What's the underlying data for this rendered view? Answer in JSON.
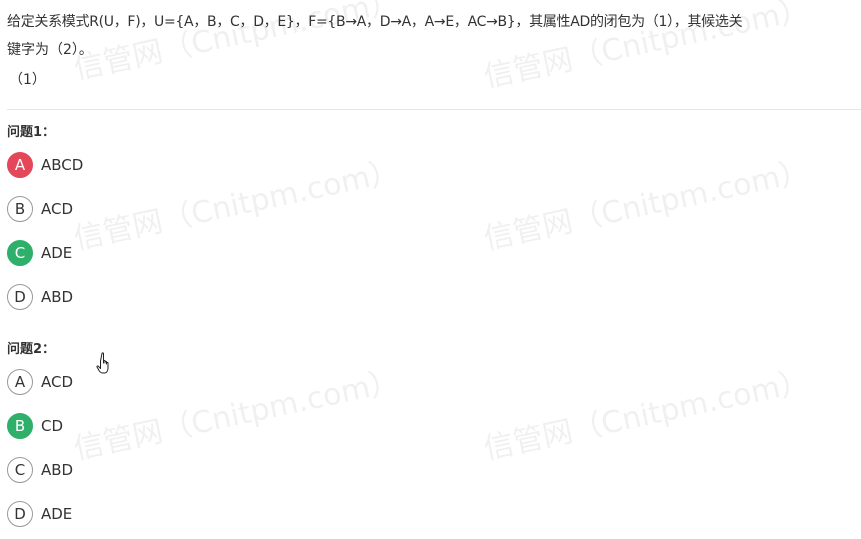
{
  "question_stem": {
    "line1": "给定关系模式R(U，F)，U={A，B，C，D，E}，F={B→A，D→A，A→E，AC→B}，其属性AD的闭包为（1），其候选关",
    "line2": "键字为（2）。",
    "sub_label": "（1）"
  },
  "watermark_text": "信管网（Cnitpm.com）",
  "questions": [
    {
      "title": "问题1：",
      "options": [
        {
          "letter": "A",
          "text": "ABCD",
          "state": "wrong"
        },
        {
          "letter": "B",
          "text": "ACD",
          "state": "normal"
        },
        {
          "letter": "C",
          "text": "ADE",
          "state": "correct"
        },
        {
          "letter": "D",
          "text": "ABD",
          "state": "normal"
        }
      ]
    },
    {
      "title": "问题2：",
      "options": [
        {
          "letter": "A",
          "text": "ACD",
          "state": "normal"
        },
        {
          "letter": "B",
          "text": "CD",
          "state": "correct"
        },
        {
          "letter": "C",
          "text": "ABD",
          "state": "normal"
        },
        {
          "letter": "D",
          "text": "ADE",
          "state": "normal"
        }
      ]
    }
  ],
  "colors": {
    "wrong": "#e5475a",
    "correct": "#2fb06a",
    "text": "#333333",
    "divider": "#e6e6e6"
  },
  "icons": {
    "cursor": "hand-pointer-icon"
  }
}
